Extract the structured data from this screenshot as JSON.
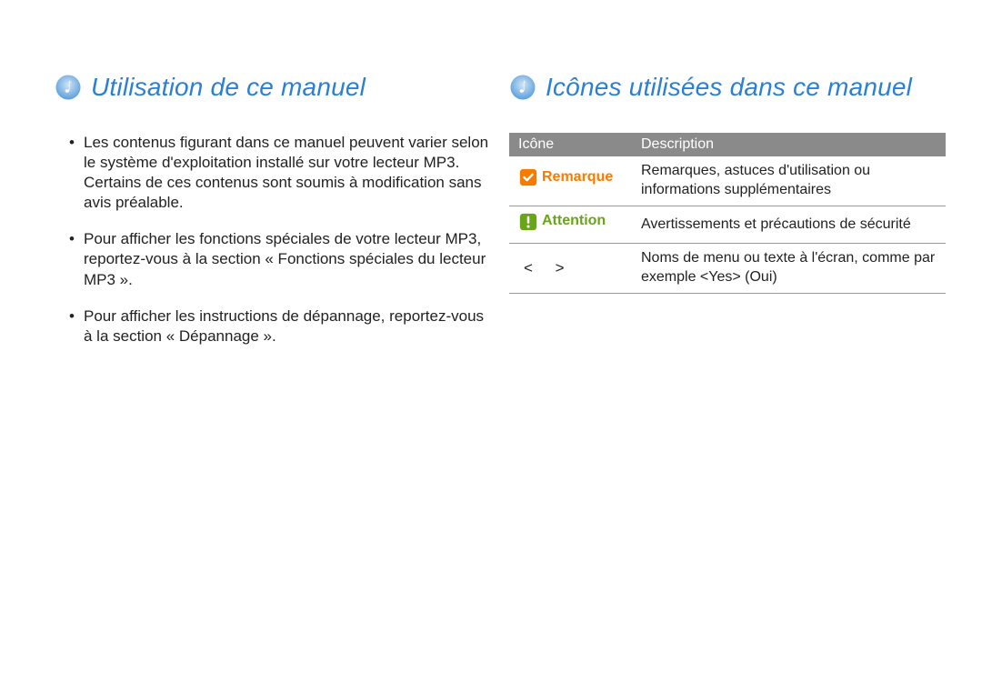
{
  "left": {
    "heading": "Utilisation de ce manuel",
    "bullets": [
      "Les contenus figurant dans ce manuel peuvent varier selon le système d'exploitation installé sur votre lecteur MP3. Certains de ces contenus sont soumis à modification sans avis préalable.",
      "Pour afficher les fonctions spéciales de votre lecteur MP3, reportez-vous à la section « Fonctions spéciales du lecteur MP3 ».",
      "Pour afficher les instructions de dépannage, reportez-vous à la section « Dépannage »."
    ]
  },
  "right": {
    "heading": "Icônes utilisées dans ce manuel",
    "table": {
      "headers": {
        "icon": "Icône",
        "desc": "Description"
      },
      "rows": [
        {
          "badge": "Remarque",
          "badge_kind": "remarque",
          "desc": "Remarques, astuces d'utilisation ou informations supplémentaires"
        },
        {
          "badge": "Attention",
          "badge_kind": "attention",
          "desc": "Avertissements et précautions de sécurité"
        },
        {
          "badge": "<   >",
          "badge_kind": "angle",
          "desc": "Noms de menu ou texte à l'écran, comme par exemple <Yes> (Oui)"
        }
      ]
    }
  }
}
